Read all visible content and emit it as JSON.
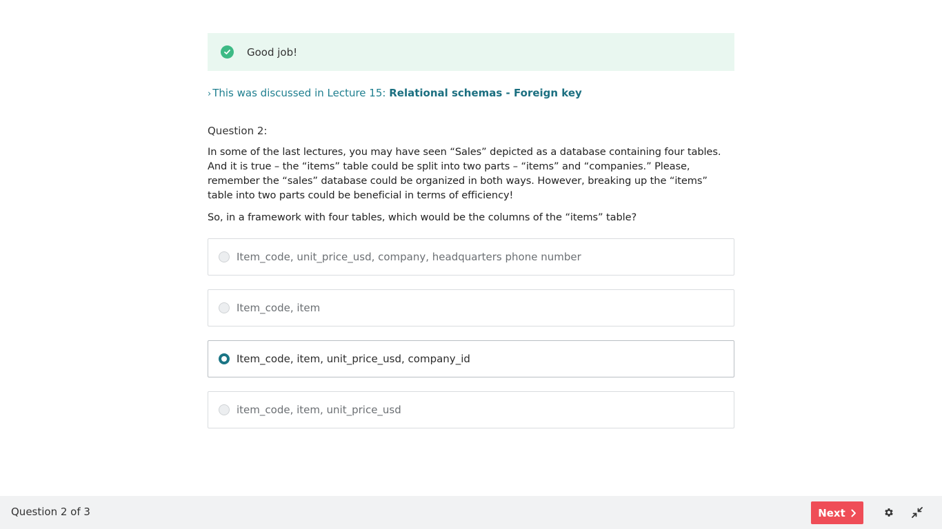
{
  "feedback": {
    "message": "Good job!",
    "status_color": "#3dba85"
  },
  "lecture_ref": {
    "prefix": "This was discussed in Lecture 15: ",
    "topic": "Relational schemas - Foreign key"
  },
  "question": {
    "number_label": "Question 2:",
    "body": "In some of the last lectures, you may have seen “Sales” depicted as a database containing four tables. And it is true – the “items” table could be split into two parts – “items” and “companies.” Please, remember the “sales” database could be organized in both ways. However, breaking up the “items” table into two parts could be beneficial in terms of efficiency!",
    "prompt": "So, in a framework with four tables, which would be the columns of the “items” table?",
    "options": [
      {
        "label": "Item_code, unit_price_usd, company, headquarters phone number",
        "selected": false
      },
      {
        "label": "Item_code, item",
        "selected": false
      },
      {
        "label": "Item_code, item, unit_price_usd, company_id",
        "selected": true
      },
      {
        "label": "item_code, item, unit_price_usd",
        "selected": false
      }
    ]
  },
  "footer": {
    "progress": "Question 2 of 3",
    "next_label": "Next",
    "accent_color": "#ef4d57",
    "icons": [
      "gear-icon",
      "collapse-icon"
    ]
  }
}
